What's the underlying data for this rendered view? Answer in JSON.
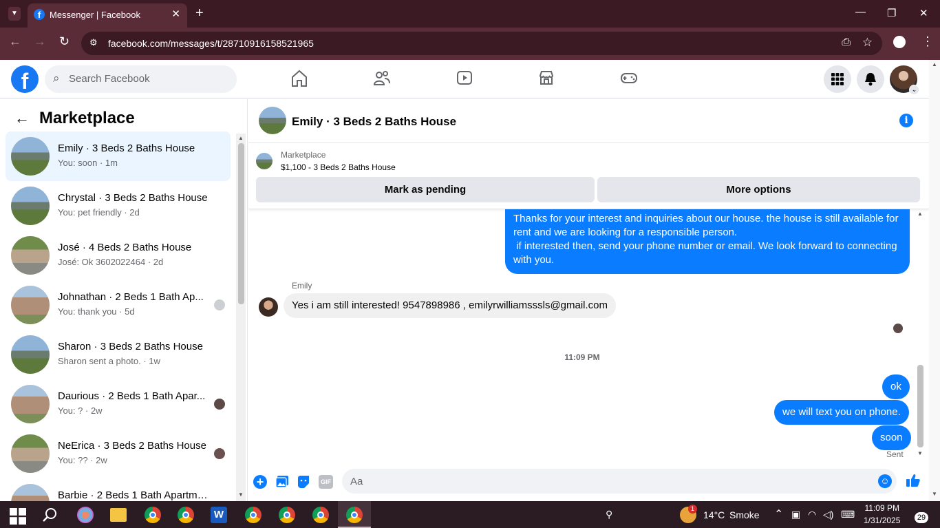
{
  "browser": {
    "tab_title": "Messenger | Facebook",
    "tab_close": "✕",
    "new_tab": "+",
    "url": "facebook.com/messages/t/28710916158521965",
    "window_minimize": "—",
    "window_restore": "❐",
    "window_close": "✕"
  },
  "fb": {
    "logo": "f",
    "search_placeholder": "Search Facebook",
    "nav_icons": [
      "home-icon",
      "friends-icon",
      "watch-icon",
      "marketplace-icon",
      "gaming-icon"
    ]
  },
  "sidebar": {
    "title": "Marketplace",
    "back": "←",
    "conversations": [
      {
        "name": "Emily · 3 Beds 2 Baths House",
        "sub": "You: soon · 1m",
        "active": true
      },
      {
        "name": "Chrystal · 3 Beds 2 Baths House",
        "sub": "You: pet friendly · 2d"
      },
      {
        "name": "José · 4 Beds 2 Baths House",
        "sub": "José: Ok 3602022464 · 2d"
      },
      {
        "name": "Johnathan · 2 Beds 1 Bath Ap...",
        "sub": "You: thank you · 5d"
      },
      {
        "name": "Sharon · 3 Beds 2 Baths House",
        "sub": "Sharon sent a photo. · 1w"
      },
      {
        "name": "Daurious · 2 Beds 1 Bath Apar...",
        "sub": "You: ? · 2w"
      },
      {
        "name": "NeErica · 3 Beds 2 Baths House",
        "sub": "You: ?? · 2w"
      },
      {
        "name": "Barbie · 2 Beds 1 Bath Apartmen...",
        "sub": ""
      }
    ]
  },
  "chat": {
    "title": "Emily · 3 Beds 2 Baths House",
    "info": "i",
    "marketplace_label": "Marketplace",
    "listing": "$1,100 - 3 Beds 2 Baths House",
    "mark_pending": "Mark as pending",
    "more_options": "More options",
    "outgoing_long": "Thanks for your interest and inquiries about our house. the house is still available for rent and we are looking for a responsible person.\n if interested then, send your phone number or email. We look forward to connecting with you.",
    "sender_name": "Emily",
    "incoming": "Yes i am still interested! 9547898986 , emilyrwilliamsssls@gmail.com",
    "timestamp": "11:09 PM",
    "msg_ok": "ok",
    "msg_text": "we will text you on phone.",
    "msg_soon": "soon",
    "status": "Sent",
    "composer_placeholder": "Aa",
    "gif": "GIF"
  },
  "taskbar": {
    "weather_temp": "14°C",
    "weather_desc": "Smoke",
    "weather_badge": "1",
    "time": "11:09 PM",
    "date": "1/31/2025",
    "notif_count": "29"
  }
}
